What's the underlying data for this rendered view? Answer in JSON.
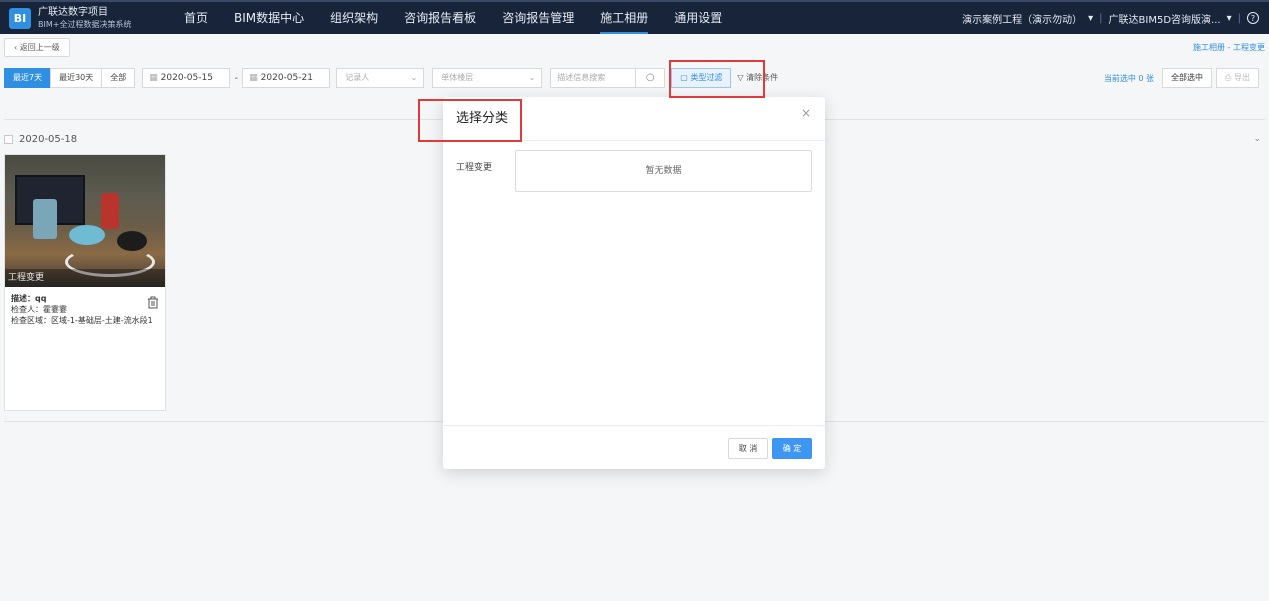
{
  "header": {
    "logo_text": "BI",
    "brand_title": "广联达数字项目",
    "brand_subtitle": "BIM+全过程数据决策系统",
    "nav": [
      {
        "label": "首页"
      },
      {
        "label": "BIM数据中心"
      },
      {
        "label": "组织架构"
      },
      {
        "label": "咨询报告看板"
      },
      {
        "label": "咨询报告管理"
      },
      {
        "label": "施工相册"
      },
      {
        "label": "通用设置"
      }
    ],
    "active_nav": "施工相册",
    "project": "演示案例工程（演示勿动）",
    "company": "广联达BIM5D咨询版演...",
    "help_icon": "?"
  },
  "toolbar": {
    "back_label": "返回上一级",
    "breadcrumb": "施工相册 - 工程变更",
    "segments": [
      {
        "label": "最近7天",
        "active": true
      },
      {
        "label": "最近30天",
        "active": false
      },
      {
        "label": "全部",
        "active": false
      }
    ],
    "date_from": "2020-05-15",
    "date_to": "2020-05-21",
    "date_separator": "-",
    "recorder_placeholder": "记录人",
    "building_placeholder": "单体楼层",
    "search_placeholder": "描述信息搜索",
    "type_filter_label": "类型过滤",
    "clear_label": "清除条件",
    "selected_count": "当前选中 0 张",
    "select_all_label": "全部选中",
    "export_label": "导出"
  },
  "album": {
    "group_date": "2020-05-18",
    "card": {
      "tag": "工程变更",
      "desc_label": "描述：",
      "desc_value": "qq",
      "inspector": "检查人：霍霎霎",
      "area": "检查区域：区域-1-基础层-土建-流水段1"
    }
  },
  "modal": {
    "title": "选择分类",
    "field_label": "工程变更",
    "empty_text": "暂无数据",
    "cancel_label": "取 消",
    "ok_label": "确 定"
  },
  "colors": {
    "topbar": "#17243a",
    "accent": "#2f8fe0",
    "highlight": "#e03a3a"
  }
}
